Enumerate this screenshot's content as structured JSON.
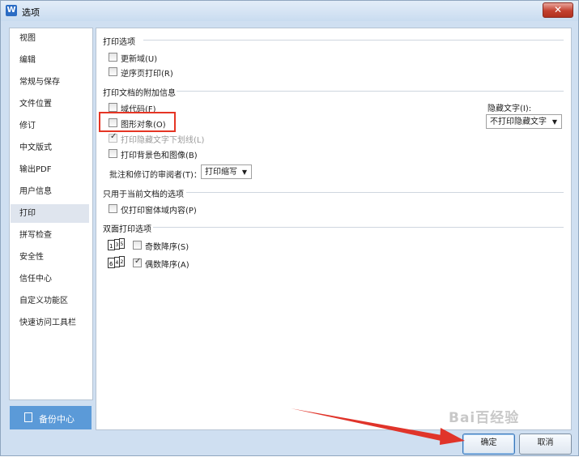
{
  "window": {
    "title": "选项",
    "app_icon_letter": "W",
    "close_symbol": "✕"
  },
  "sidebar": {
    "items": [
      {
        "label": "视图"
      },
      {
        "label": "编辑"
      },
      {
        "label": "常规与保存"
      },
      {
        "label": "文件位置"
      },
      {
        "label": "修订"
      },
      {
        "label": "中文版式"
      },
      {
        "label": "输出PDF"
      },
      {
        "label": "用户信息"
      },
      {
        "label": "打印",
        "selected": true
      },
      {
        "label": "拼写检查"
      },
      {
        "label": "安全性"
      },
      {
        "label": "信任中心"
      },
      {
        "label": "自定义功能区"
      },
      {
        "label": "快速访问工具栏"
      }
    ],
    "backup_button_label": "备份中心"
  },
  "panel": {
    "print_options": {
      "title": "打印选项",
      "update_fields": {
        "label": "更新域(U)",
        "checked": false
      },
      "reverse_order": {
        "label": "逆序页打印(R)",
        "checked": false
      }
    },
    "doc_extra": {
      "title": "打印文档的附加信息",
      "field_codes": {
        "label": "域代码(F)",
        "checked": false
      },
      "drawing_objects": {
        "label": "图形对象(O)",
        "checked": false
      },
      "hidden_text_underline": {
        "label": "打印隐藏文字下划线(L)",
        "checked": true,
        "disabled": true
      },
      "background_colors_images": {
        "label": "打印背景色和图像(B)",
        "checked": false
      },
      "reviewer_label": "批注和修订的审阅者(T)：",
      "reviewer_value": "打印缩写",
      "hidden_text_label": "隐藏文字(I):",
      "hidden_text_value": "不打印隐藏文字"
    },
    "current_doc": {
      "title": "只用于当前文档的选项",
      "print_form_data": {
        "label": "仅打印窗体域内容(P)",
        "checked": false
      }
    },
    "duplex": {
      "title": "双面打印选项",
      "odd_reverse": {
        "label": "奇数降序(S)",
        "checked": false,
        "icon_digits": "1 3 5"
      },
      "even_reverse": {
        "label": "偶数降序(A)",
        "checked": true,
        "icon_digits": "6 4 2"
      }
    }
  },
  "footer": {
    "ok_label": "确定",
    "cancel_label": "取消"
  },
  "watermark": "Bai百经验",
  "accent_colors": {
    "highlight_box": "#e53524",
    "arrow": "#e0342a",
    "backup_button": "#5b9ad8"
  }
}
